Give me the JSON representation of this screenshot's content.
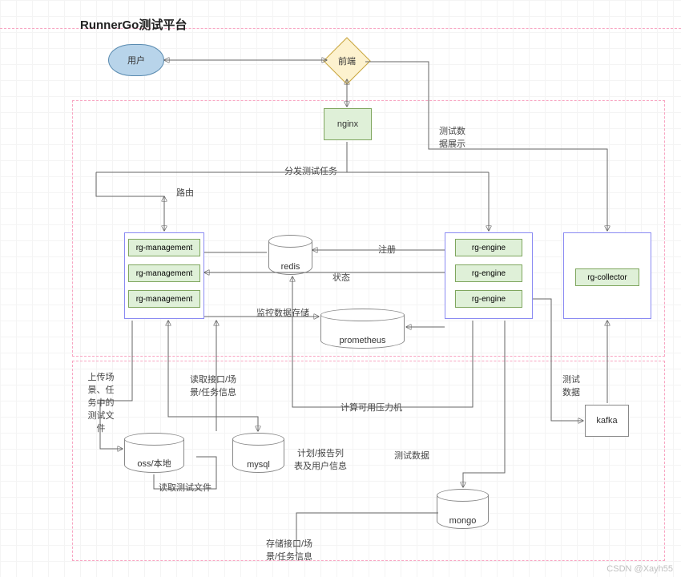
{
  "title": "RunnerGo测试平台",
  "watermark": "CSDN @Xayh55",
  "nodes": {
    "user": "用户",
    "frontend": "前端",
    "nginx": "nginx",
    "redis": "redis",
    "prometheus": "prometheus",
    "oss": "oss/本地",
    "mysql": "mysql",
    "mongo": "mongo",
    "kafka": "kafka",
    "rg_management": [
      "rg-management",
      "rg-management",
      "rg-management"
    ],
    "rg_engine": [
      "rg-engine",
      "rg-engine",
      "rg-engine"
    ],
    "rg_collector": "rg-collector"
  },
  "edges": {
    "route": "路由",
    "dispatch_test_task": "分发测试任务",
    "test_data_display": "测试数\n据展示",
    "register": "注册",
    "state": "状态",
    "monitor_store": "监控数据存储",
    "upload_scene_files": "上传场\n景、任\n务中的\n测试文\n件",
    "read_api_scene_task": "读取接口/场\n景/任务信息",
    "read_test_files": "读取测试文件",
    "plan_report_user": "计划/报告列\n表及用户信息",
    "compute_pressure": "计算可用压力机",
    "test_data": "测试数据",
    "test_data_kafka": "测试\n数据",
    "store_api_scene_task": "存储接口/场\n景/任务信息"
  }
}
